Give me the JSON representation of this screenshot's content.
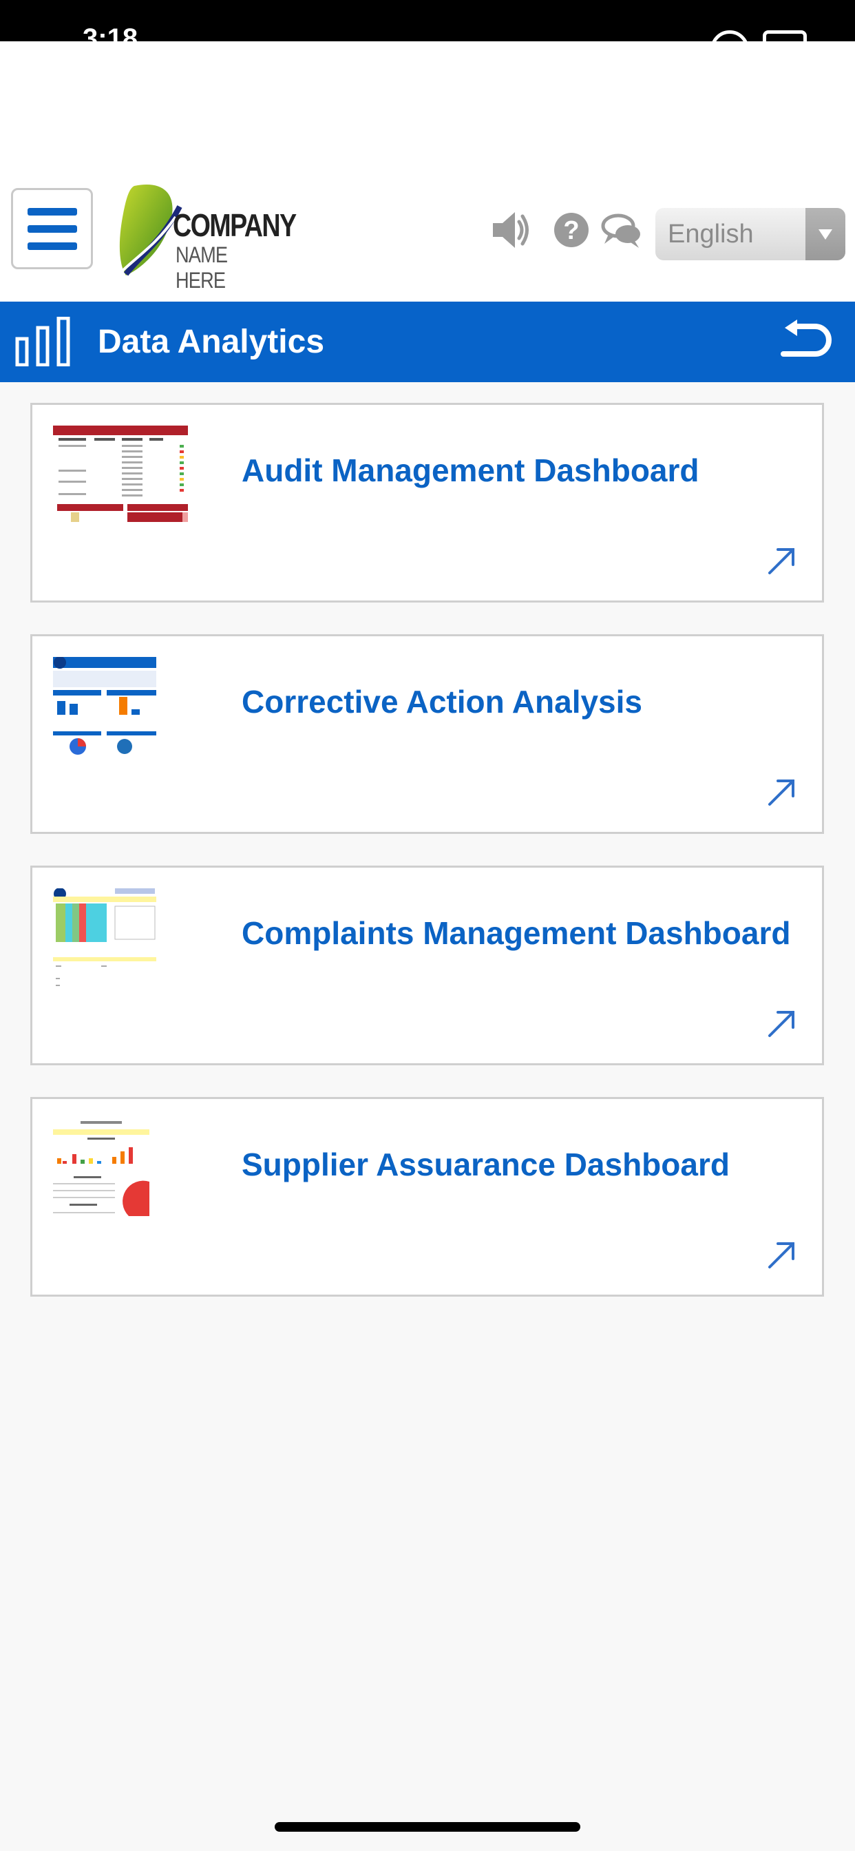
{
  "status_bar": {
    "time": "3:18"
  },
  "header": {
    "logo_line1": "COMPANY",
    "logo_line2": "NAME HERE",
    "language": "English",
    "icons": [
      "menu-icon",
      "speaker-icon",
      "help-icon",
      "chat-icon",
      "dropdown-arrow-icon"
    ]
  },
  "title_bar": {
    "title": "Data Analytics",
    "background": "#0763c9",
    "icons": [
      "bar-chart-icon",
      "back-icon"
    ]
  },
  "cards": [
    {
      "title": "Audit Management Dashboard",
      "thumbnail_icon": "audit-schedule-thumbnail"
    },
    {
      "title": "Corrective Action Analysis",
      "thumbnail_icon": "audit-summary-thumbnail"
    },
    {
      "title": "Complaints Management Dashboard",
      "thumbnail_icon": "complaints-dashboard-thumbnail"
    },
    {
      "title": "Supplier Assuarance Dashboard",
      "thumbnail_icon": "supplier-summary-thumbnail"
    }
  ],
  "colors": {
    "accent": "#0b63c4",
    "title_bar": "#0763c9",
    "card_border": "#cfcfcf"
  }
}
